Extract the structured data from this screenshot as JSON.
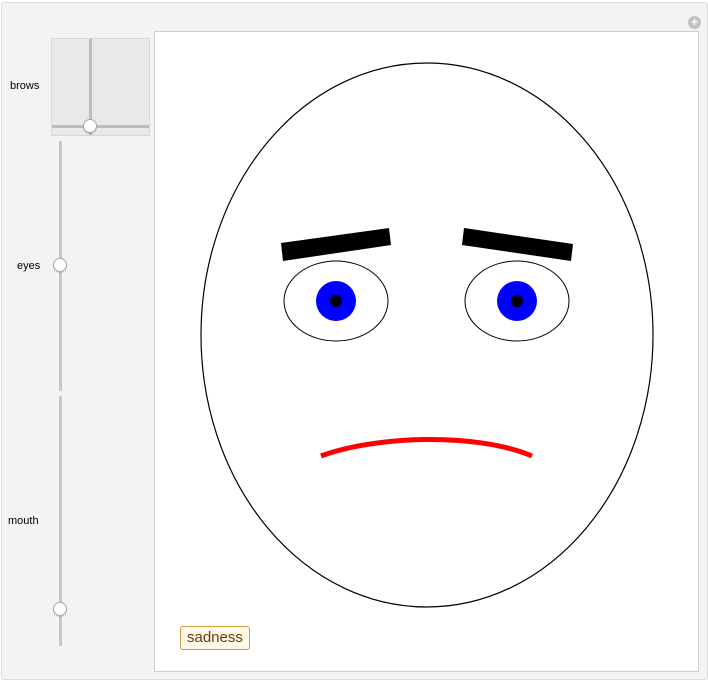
{
  "controls": {
    "brows_label": "brows",
    "eyes_label": "eyes",
    "mouth_label": "mouth",
    "add_icon": "plus-icon"
  },
  "face": {
    "emotion_label": "sadness",
    "eye_iris_color": "#0000ff",
    "mouth_color": "#ff0000",
    "brow_color": "#000000"
  }
}
